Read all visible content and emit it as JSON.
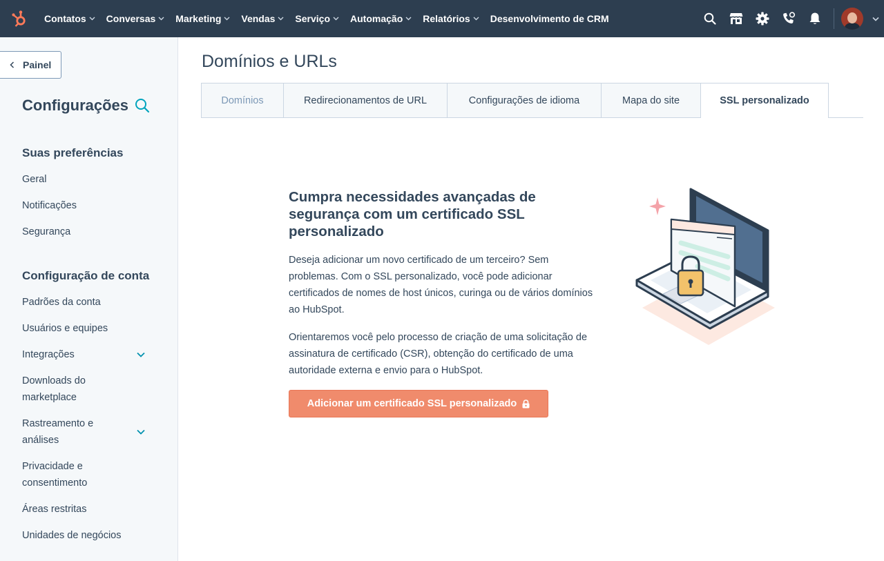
{
  "topnav": {
    "items": [
      {
        "label": "Contatos",
        "dropdown": true
      },
      {
        "label": "Conversas",
        "dropdown": true
      },
      {
        "label": "Marketing",
        "dropdown": true
      },
      {
        "label": "Vendas",
        "dropdown": true
      },
      {
        "label": "Serviço",
        "dropdown": true
      },
      {
        "label": "Automação",
        "dropdown": true
      },
      {
        "label": "Relatórios",
        "dropdown": true
      },
      {
        "label": "Desenvolvimento de CRM",
        "dropdown": false
      }
    ],
    "icons": [
      "search-icon",
      "marketplace-icon",
      "settings-gear-icon",
      "calling-icon",
      "notifications-bell-icon"
    ]
  },
  "sidebar": {
    "back_label": "Painel",
    "title": "Configurações",
    "sections": [
      {
        "heading": "Suas preferências",
        "items": [
          {
            "label": "Geral"
          },
          {
            "label": "Notificações"
          },
          {
            "label": "Segurança"
          }
        ]
      },
      {
        "heading": "Configuração de conta",
        "items": [
          {
            "label": "Padrões da conta"
          },
          {
            "label": "Usuários e equipes"
          },
          {
            "label": "Integrações",
            "expandable": true
          },
          {
            "label": "Downloads do marketplace"
          },
          {
            "label": "Rastreamento e análises",
            "expandable": true
          },
          {
            "label": "Privacidade e consentimento"
          },
          {
            "label": "Áreas restritas"
          },
          {
            "label": "Unidades de negócios"
          }
        ]
      }
    ]
  },
  "main": {
    "title": "Domínios e URLs",
    "tabs": [
      {
        "label": "Domínios",
        "state": "dim"
      },
      {
        "label": "Redirecionamentos de URL",
        "state": "normal"
      },
      {
        "label": "Configurações de idioma",
        "state": "normal"
      },
      {
        "label": "Mapa do site",
        "state": "normal"
      },
      {
        "label": "SSL personalizado",
        "state": "active"
      }
    ],
    "heading": "Cumpra necessidades avançadas de segurança com um certificado SSL personalizado",
    "paragraph1": "Deseja adicionar um novo certificado de um terceiro? Sem problemas. Com o SSL personalizado, você pode adicionar certificados de nomes de host únicos, curinga ou de vários domínios ao HubSpot.",
    "paragraph2": "Orientaremos você pelo processo de criação de uma solicitação de assinatura de certificado (CSR), obtenção do certificado de uma autoridade externa e envio para o HubSpot.",
    "cta_label": "Adicionar um certificado SSL personalizado"
  },
  "colors": {
    "nav_bg": "#2d3e50",
    "sidebar_bg": "#f5f8fa",
    "text": "#33475b",
    "cta_bg": "#f08b6c",
    "hubspot_orange": "#ff7a59"
  }
}
